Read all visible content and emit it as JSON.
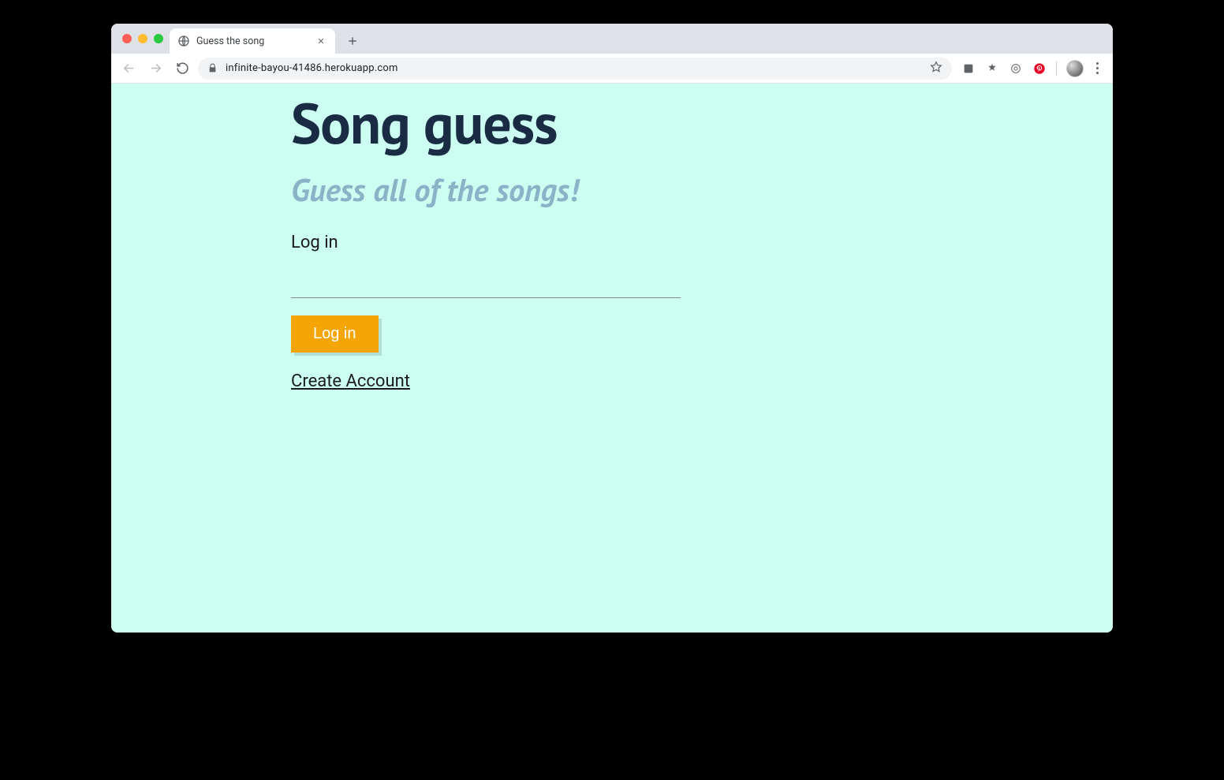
{
  "browser": {
    "tab_title": "Guess the song",
    "url": "infinite-bayou-41486.herokuapp.com"
  },
  "page": {
    "heading": "Song guess",
    "subheading": "Guess all of the songs!",
    "login_label": "Log in",
    "login_input_value": "",
    "login_button_label": "Log in",
    "create_account_label": "Create Account"
  }
}
